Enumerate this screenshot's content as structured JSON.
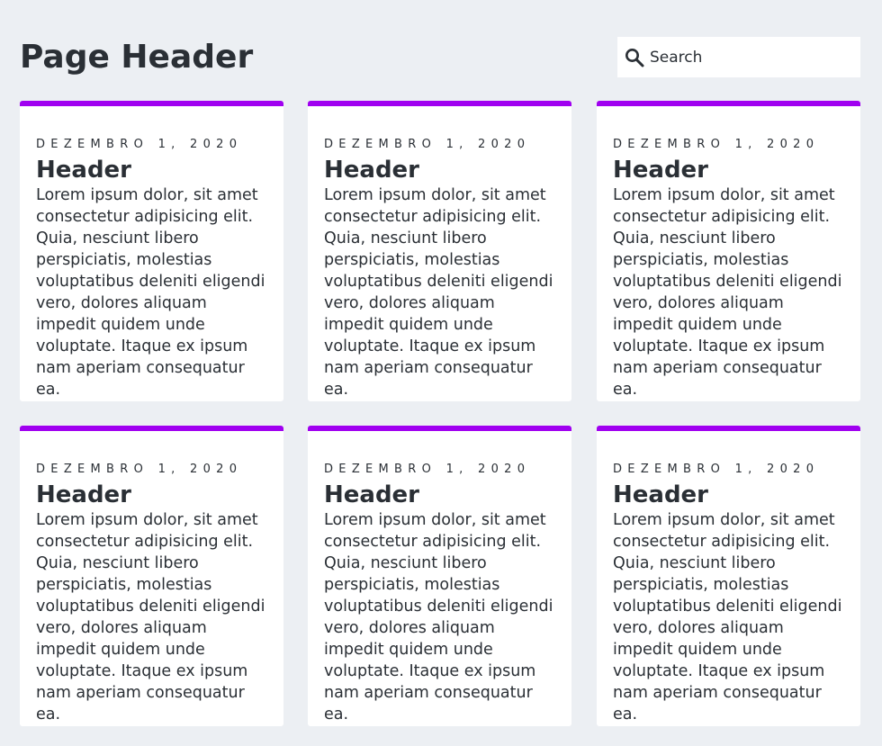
{
  "page": {
    "title": "Page Header"
  },
  "search": {
    "placeholder": "Search"
  },
  "icons": {
    "search": "search-icon"
  },
  "colors": {
    "accent": "#a000f0",
    "background": "#eceff3",
    "text": "#2a2f35",
    "card": "#ffffff"
  },
  "cards": [
    {
      "date": "DEZEMBRO 1, 2020",
      "title": "Header",
      "body": "Lorem ipsum dolor, sit amet consectetur adipisicing elit. Quia, nesciunt libero perspiciatis, molestias voluptatibus deleniti eligendi vero, dolores aliquam impedit quidem unde voluptate. Itaque ex ipsum nam aperiam consequatur ea."
    },
    {
      "date": "DEZEMBRO 1, 2020",
      "title": "Header",
      "body": "Lorem ipsum dolor, sit amet consectetur adipisicing elit. Quia, nesciunt libero perspiciatis, molestias voluptatibus deleniti eligendi vero, dolores aliquam impedit quidem unde voluptate. Itaque ex ipsum nam aperiam consequatur ea."
    },
    {
      "date": "DEZEMBRO 1, 2020",
      "title": "Header",
      "body": "Lorem ipsum dolor, sit amet consectetur adipisicing elit. Quia, nesciunt libero perspiciatis, molestias voluptatibus deleniti eligendi vero, dolores aliquam impedit quidem unde voluptate. Itaque ex ipsum nam aperiam consequatur ea."
    },
    {
      "date": "DEZEMBRO 1, 2020",
      "title": "Header",
      "body": "Lorem ipsum dolor, sit amet consectetur adipisicing elit. Quia, nesciunt libero perspiciatis, molestias voluptatibus deleniti eligendi vero, dolores aliquam impedit quidem unde voluptate. Itaque ex ipsum nam aperiam consequatur ea."
    },
    {
      "date": "DEZEMBRO 1, 2020",
      "title": "Header",
      "body": "Lorem ipsum dolor, sit amet consectetur adipisicing elit. Quia, nesciunt libero perspiciatis, molestias voluptatibus deleniti eligendi vero, dolores aliquam impedit quidem unde voluptate. Itaque ex ipsum nam aperiam consequatur ea."
    },
    {
      "date": "DEZEMBRO 1, 2020",
      "title": "Header",
      "body": "Lorem ipsum dolor, sit amet consectetur adipisicing elit. Quia, nesciunt libero perspiciatis, molestias voluptatibus deleniti eligendi vero, dolores aliquam impedit quidem unde voluptate. Itaque ex ipsum nam aperiam consequatur ea."
    }
  ]
}
